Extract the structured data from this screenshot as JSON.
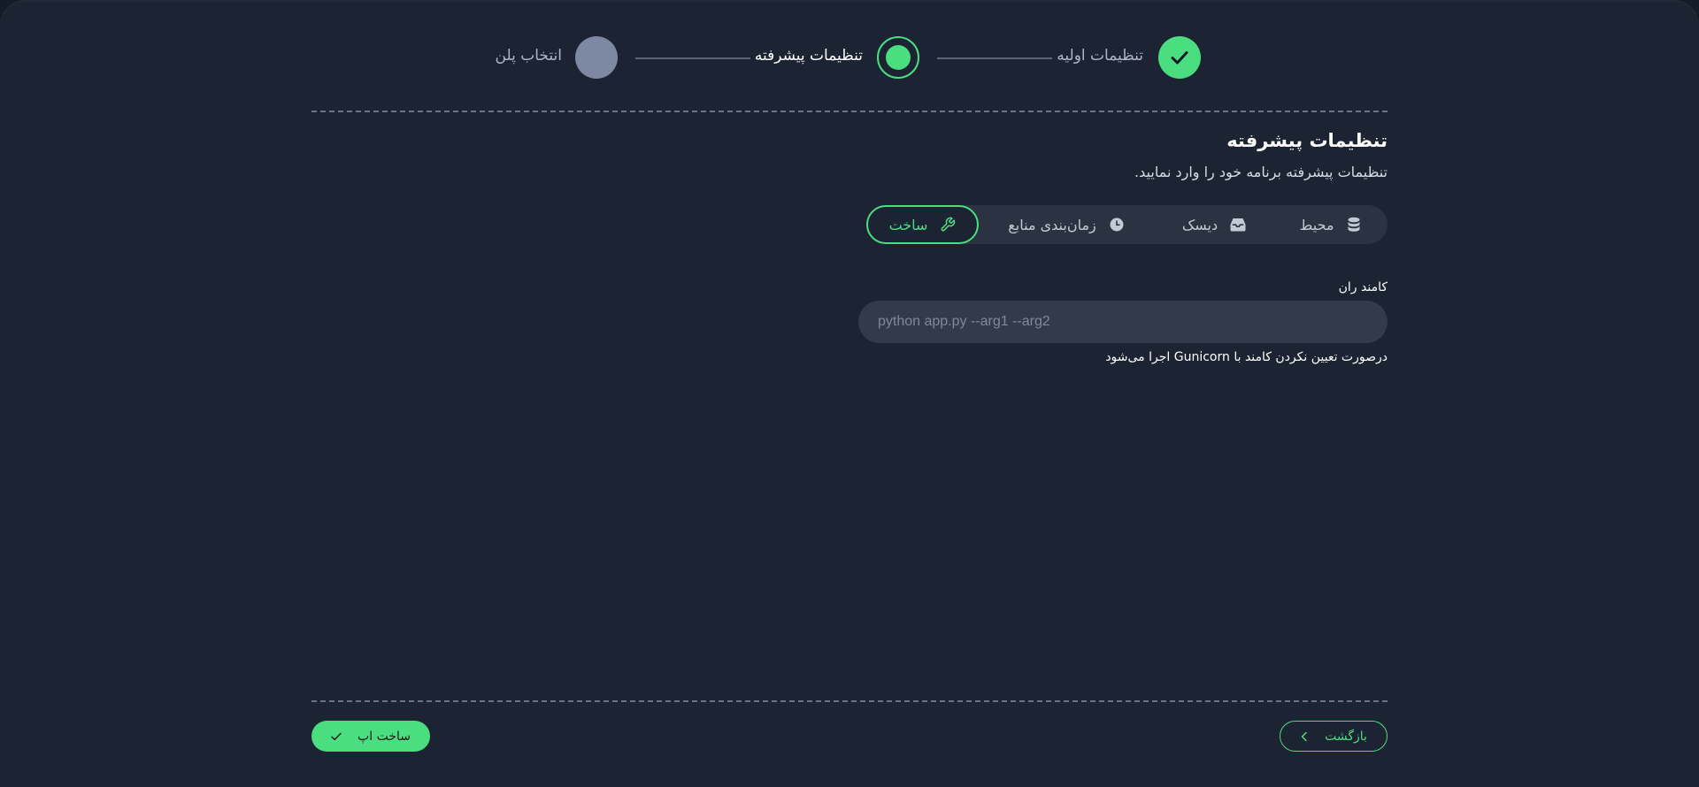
{
  "stepper": {
    "steps": [
      {
        "label": "تنظیمات اولیه",
        "state": "done"
      },
      {
        "label": "تنظیمات پیشرفته",
        "state": "active"
      },
      {
        "label": "انتخاب پلن",
        "state": "pending"
      }
    ]
  },
  "header": {
    "title": "تنظیمات پیشرفته",
    "subtitle": "تنظیمات پیشرفته برنامه خود را وارد نمایید."
  },
  "tabs": [
    {
      "label": "محیط",
      "icon": "database-icon",
      "active": false
    },
    {
      "label": "دیسک",
      "icon": "inbox-icon",
      "active": false
    },
    {
      "label": "زمان‌بندی منابع",
      "icon": "clock-icon",
      "active": false
    },
    {
      "label": "ساخت",
      "icon": "wrench-icon",
      "active": true
    }
  ],
  "form": {
    "run_command": {
      "label": "کامند ران",
      "value": "",
      "placeholder": "python app.py --arg1 --arg2",
      "hint": "درصورت تعیین نکردن کامند با Gunicorn اجرا می‌شود"
    }
  },
  "footer": {
    "back_label": "بازگشت",
    "create_label": "ساخت اپ"
  },
  "colors": {
    "accent": "#4ade80",
    "background": "#1c2333",
    "pending_step": "#7d88a3"
  }
}
